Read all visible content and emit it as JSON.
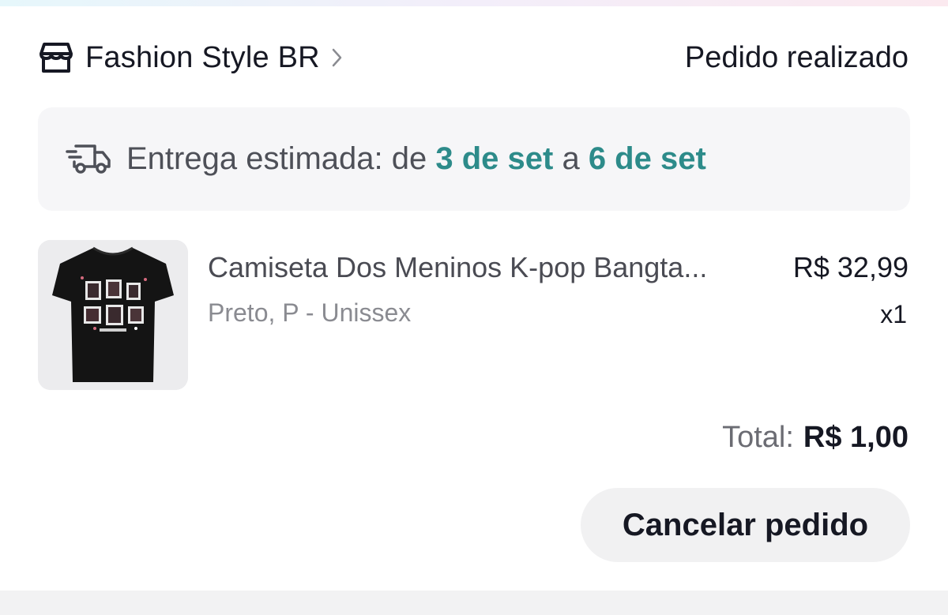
{
  "header": {
    "shop_name": "Fashion Style BR",
    "order_status": "Pedido realizado",
    "icons": {
      "store": "store-icon",
      "chevron": "chevron-right-icon"
    }
  },
  "delivery": {
    "prefix": "Entrega estimada: de ",
    "start_date": "3 de set",
    "middle": " a ",
    "end_date": "6 de set",
    "icon": "fast-delivery-truck-icon",
    "accent_color": "#2d8b8a"
  },
  "product": {
    "name": "Camiseta Dos Meninos K-pop Bangta...",
    "variant": "Preto, P - Unissex",
    "price": "R$ 32,99",
    "quantity": "x1",
    "image": "black-tshirt-image"
  },
  "total": {
    "label": "Total:",
    "value": "R$ 1,00"
  },
  "actions": {
    "cancel_label": "Cancelar pedido"
  }
}
